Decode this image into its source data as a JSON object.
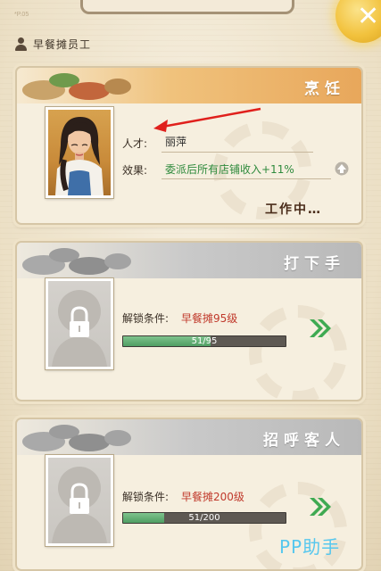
{
  "header": {
    "page_number": "*P.05",
    "close_glyph": "✕"
  },
  "section": {
    "title": "早餐摊员工"
  },
  "cards": [
    {
      "title": "烹饪",
      "state": "active",
      "talent_label": "人才:",
      "talent_name": "丽萍",
      "effect_label": "效果:",
      "effect_text": "委派后所有店铺收入+11%",
      "status": "工作中…"
    },
    {
      "title": "打下手",
      "state": "locked",
      "condition_label": "解锁条件:",
      "condition_value": "早餐摊95级",
      "progress_text": "51/95",
      "progress_fraction": 0.537
    },
    {
      "title": "招呼客人",
      "state": "locked",
      "condition_label": "解锁条件:",
      "condition_value": "早餐摊200级",
      "progress_text": "51/200",
      "progress_fraction": 0.255
    }
  ],
  "watermark": "PP助手",
  "colors": {
    "active_header": "#e8a75b",
    "locked_header": "#b9b9b9",
    "condition_red": "#c0392b",
    "effect_green": "#2e8a3c",
    "arrow_green": "#3faa52",
    "annotation_red": "#e0201c"
  },
  "icons": [
    "user-icon",
    "close-icon",
    "lock-icon",
    "up-arrow-icon",
    "double-chevron-right-icon",
    "annotation-arrow"
  ]
}
